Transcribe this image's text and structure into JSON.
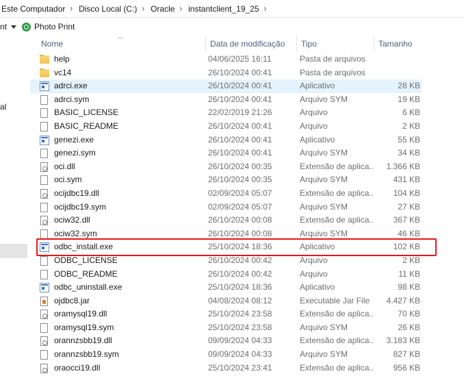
{
  "breadcrumb": [
    "Este Computador",
    "Disco Local (C:)",
    "Oracle",
    "instantclient_19_25"
  ],
  "toolbar": {
    "cut_label": "nt",
    "photo_print_label": "Photo Print"
  },
  "nav": {
    "partial_label": "al"
  },
  "columns": {
    "name": "Nome",
    "date": "Data de modificação",
    "type": "Tipo",
    "size": "Tamanho"
  },
  "accent": {
    "highlight_color": "#e8141c",
    "hover_row_color": "#e5f3ff"
  },
  "files": [
    {
      "name": "help",
      "date": "04/06/2025 16:11",
      "type": "Pasta de arquivos",
      "size": "",
      "icon": "folder-icon"
    },
    {
      "name": "vc14",
      "date": "26/10/2024 00:41",
      "type": "Pasta de arquivos",
      "size": "",
      "icon": "folder-icon"
    },
    {
      "name": "adrci.exe",
      "date": "26/10/2024 00:41",
      "type": "Aplicativo",
      "size": "28 KB",
      "icon": "exe-icon"
    },
    {
      "name": "adrci.sym",
      "date": "26/10/2024 00:41",
      "type": "Arquivo SYM",
      "size": "19 KB",
      "icon": "file-icon"
    },
    {
      "name": "BASIC_LICENSE",
      "date": "22/02/2019 21:26",
      "type": "Arquivo",
      "size": "6 KB",
      "icon": "file-icon"
    },
    {
      "name": "BASIC_README",
      "date": "26/10/2024 00:41",
      "type": "Arquivo",
      "size": "2 KB",
      "icon": "file-icon"
    },
    {
      "name": "genezi.exe",
      "date": "26/10/2024 00:41",
      "type": "Aplicativo",
      "size": "55 KB",
      "icon": "exe-icon"
    },
    {
      "name": "genezi.sym",
      "date": "26/10/2024 00:41",
      "type": "Arquivo SYM",
      "size": "34 KB",
      "icon": "file-icon"
    },
    {
      "name": "oci.dll",
      "date": "26/10/2024 00:35",
      "type": "Extensão de aplica...",
      "size": "1.366 KB",
      "icon": "dll-icon"
    },
    {
      "name": "oci.sym",
      "date": "26/10/2024 00:35",
      "type": "Arquivo SYM",
      "size": "431 KB",
      "icon": "file-icon"
    },
    {
      "name": "ocijdbc19.dll",
      "date": "02/09/2024 05:07",
      "type": "Extensão de aplica...",
      "size": "104 KB",
      "icon": "dll-icon"
    },
    {
      "name": "ocijdbc19.sym",
      "date": "02/09/2024 05:07",
      "type": "Arquivo SYM",
      "size": "27 KB",
      "icon": "file-icon"
    },
    {
      "name": "ociw32.dll",
      "date": "26/10/2024 00:08",
      "type": "Extensão de aplica...",
      "size": "367 KB",
      "icon": "dll-icon"
    },
    {
      "name": "ociw32.sym",
      "date": "26/10/2024 00:08",
      "type": "Arquivo SYM",
      "size": "46 KB",
      "icon": "file-icon"
    },
    {
      "name": "odbc_install.exe",
      "date": "25/10/2024 18:36",
      "type": "Aplicativo",
      "size": "102 KB",
      "icon": "exe-icon"
    },
    {
      "name": "ODBC_LICENSE",
      "date": "26/10/2024 00:42",
      "type": "Arquivo",
      "size": "2 KB",
      "icon": "file-icon"
    },
    {
      "name": "ODBC_README",
      "date": "26/10/2024 00:42",
      "type": "Arquivo",
      "size": "11 KB",
      "icon": "file-icon"
    },
    {
      "name": "odbc_uninstall.exe",
      "date": "25/10/2024 18:36",
      "type": "Aplicativo",
      "size": "98 KB",
      "icon": "exe-icon"
    },
    {
      "name": "ojdbc8.jar",
      "date": "04/08/2024 08:12",
      "type": "Executable Jar File",
      "size": "4.427 KB",
      "icon": "jar-icon"
    },
    {
      "name": "oramysql19.dll",
      "date": "25/10/2024 23:58",
      "type": "Extensão de aplica...",
      "size": "70 KB",
      "icon": "dll-icon"
    },
    {
      "name": "oramysql19.sym",
      "date": "25/10/2024 23:58",
      "type": "Arquivo SYM",
      "size": "26 KB",
      "icon": "file-icon"
    },
    {
      "name": "orannzsbb19.dll",
      "date": "09/09/2024 04:33",
      "type": "Extensão de aplica...",
      "size": "3.183 KB",
      "icon": "dll-icon"
    },
    {
      "name": "orannzsbb19.sym",
      "date": "09/09/2024 04:33",
      "type": "Arquivo SYM",
      "size": "827 KB",
      "icon": "file-icon"
    },
    {
      "name": "oraocci19.dll",
      "date": "25/10/2024 23:41",
      "type": "Extensão de aplica...",
      "size": "956 KB",
      "icon": "dll-icon"
    }
  ]
}
